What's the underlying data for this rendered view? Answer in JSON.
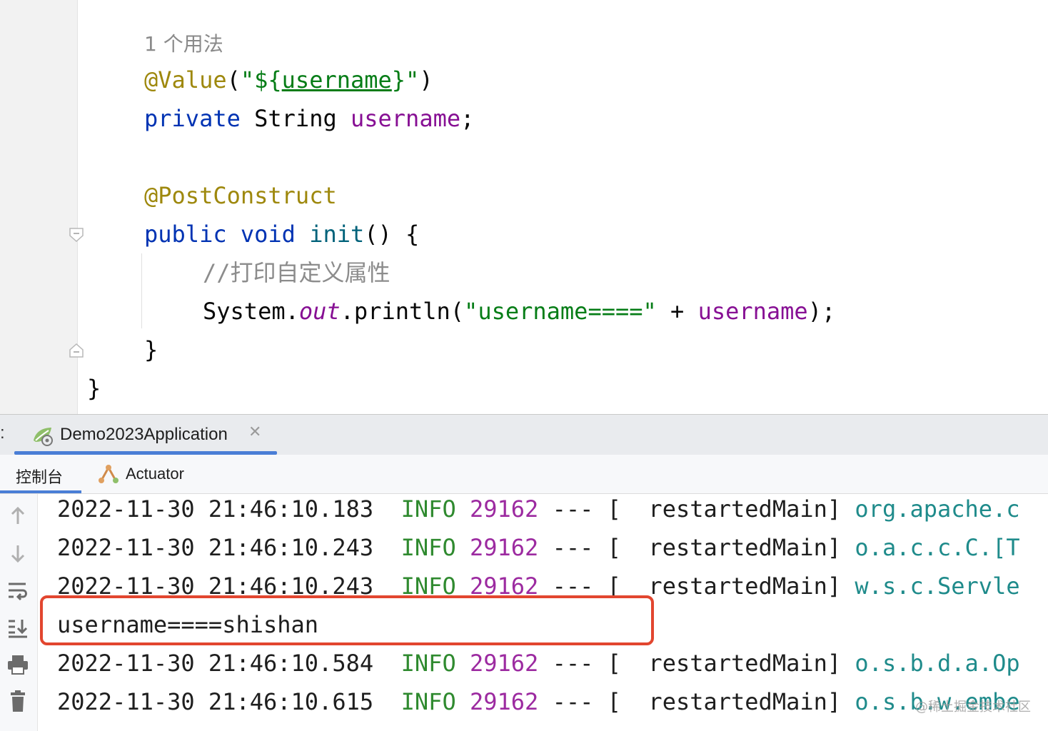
{
  "editor": {
    "usage_hint": "1 个用法",
    "lines": {
      "l1_ann": "@Value",
      "l1_p1": "(",
      "l1_str1": "\"${",
      "l1_strul": "username",
      "l1_str2": "}\"",
      "l1_p2": ")",
      "l2_kw": "private",
      "l2_type": " String ",
      "l2_fld": "username",
      "l2_end": ";",
      "l3_ann": "@PostConstruct",
      "l4_kw": "public void",
      "l4_sp": " ",
      "l4_mth": "init",
      "l4_rest": "() {",
      "l5_cmt": "//打印自定义属性",
      "l6_a": "System.",
      "l6_out": "out",
      "l6_b": ".println(",
      "l6_str": "\"username====\"",
      "l6_c": " + ",
      "l6_fld": "username",
      "l6_d": ");",
      "l7": "}",
      "l8": "}"
    }
  },
  "run_window": {
    "colon": ":",
    "tab_label": "Demo2023Application",
    "tab_close": "✕",
    "subtabs": {
      "console": "控制台",
      "actuator": "Actuator"
    },
    "log": [
      {
        "ts": "2022-11-30 21:46:10.183",
        "level": "INFO",
        "pid": "29162",
        "sep": " --- [  ",
        "thread": "restartedMain]",
        "cls": " org.apache.c"
      },
      {
        "ts": "2022-11-30 21:46:10.243",
        "level": "INFO",
        "pid": "29162",
        "sep": " --- [  ",
        "thread": "restartedMain]",
        "cls": " o.a.c.c.C.[T"
      },
      {
        "ts": "2022-11-30 21:46:10.243",
        "level": "INFO",
        "pid": "29162",
        "sep": " --- [  ",
        "thread": "restartedMain]",
        "cls": " w.s.c.Servle"
      },
      {
        "plain": "username====shishan"
      },
      {
        "ts": "2022-11-30 21:46:10.584",
        "level": "INFO",
        "pid": "29162",
        "sep": " --- [  ",
        "thread": "restartedMain]",
        "cls": " o.s.b.d.a.Op"
      },
      {
        "ts": "2022-11-30 21:46:10.615",
        "level": "INFO",
        "pid": "29162",
        "sep": " --- [  ",
        "thread": "restartedMain]",
        "cls": " o.s.b.w.embe"
      }
    ]
  },
  "watermark": "@稀土掘金技术社区",
  "colors": {
    "accent": "#4a7ed6",
    "highlight": "#e2462f"
  }
}
